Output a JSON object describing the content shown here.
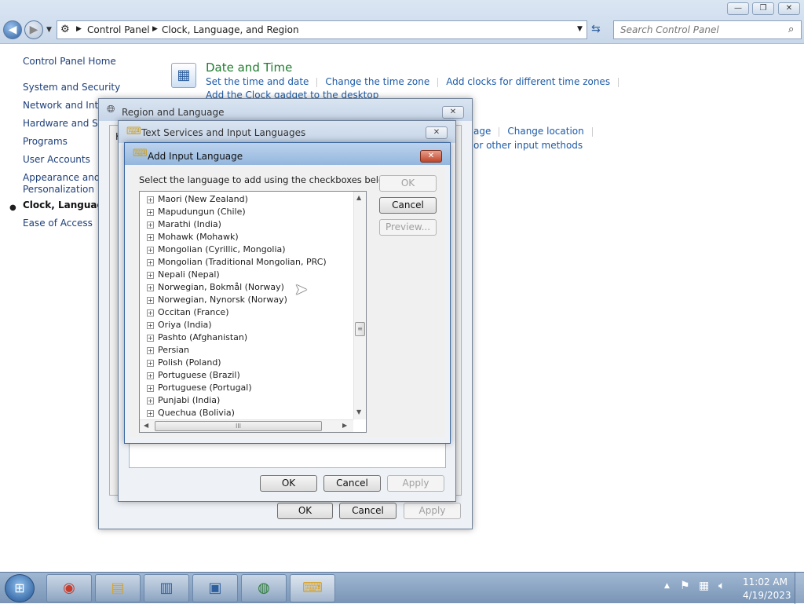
{
  "window": {
    "minimize": "—",
    "maximize": "❐",
    "close": "✕"
  },
  "address": {
    "crumbs": [
      "Control Panel",
      "Clock, Language, and Region"
    ],
    "search_placeholder": "Search Control Panel"
  },
  "leftnav": {
    "home": "Control Panel Home",
    "items": [
      "System and Security",
      "Network and Inter",
      "Hardware and Sou",
      "Programs",
      "User Accounts",
      "Appearance and",
      "Personalization",
      "Clock, Language, a",
      "Ease of Access"
    ]
  },
  "main": {
    "date_time": {
      "title": "Date and Time",
      "links": [
        "Set the time and date",
        "Change the time zone",
        "Add clocks for different time zones",
        "Add the Clock gadget to the desktop"
      ]
    },
    "region_links_partial": [
      "age",
      "Change location",
      "or other input methods"
    ]
  },
  "region_dialog": {
    "title": "Region and Language",
    "ok": "OK",
    "cancel": "Cancel",
    "apply": "Apply",
    "fragment": "K"
  },
  "text_services_dialog": {
    "title": "Text Services and Input Languages",
    "ok": "OK",
    "cancel": "Cancel",
    "apply": "Apply"
  },
  "add_input_dialog": {
    "title": "Add Input Language",
    "instruction": "Select the language to add using the checkboxes below.",
    "ok": "OK",
    "cancel": "Cancel",
    "preview": "Preview...",
    "languages": [
      "Maori (New Zealand)",
      "Mapudungun (Chile)",
      "Marathi (India)",
      "Mohawk (Mohawk)",
      "Mongolian (Cyrillic, Mongolia)",
      "Mongolian (Traditional Mongolian, PRC)",
      "Nepali (Nepal)",
      "Norwegian, Bokmål (Norway)",
      "Norwegian, Nynorsk (Norway)",
      "Occitan (France)",
      "Oriya (India)",
      "Pashto (Afghanistan)",
      "Persian",
      "Polish (Poland)",
      "Portuguese (Brazil)",
      "Portuguese (Portugal)",
      "Punjabi (India)",
      "Quechua (Bolivia)"
    ],
    "scroll_grip": "III"
  },
  "taskbar": {
    "items": [
      "start-orb",
      "chrome-icon",
      "explorer-icon",
      "control-panel-icon",
      "computer-icon",
      "clock-globe-icon",
      "keyboard-icon"
    ],
    "time": "11:02 AM",
    "date": "4/19/2023"
  }
}
